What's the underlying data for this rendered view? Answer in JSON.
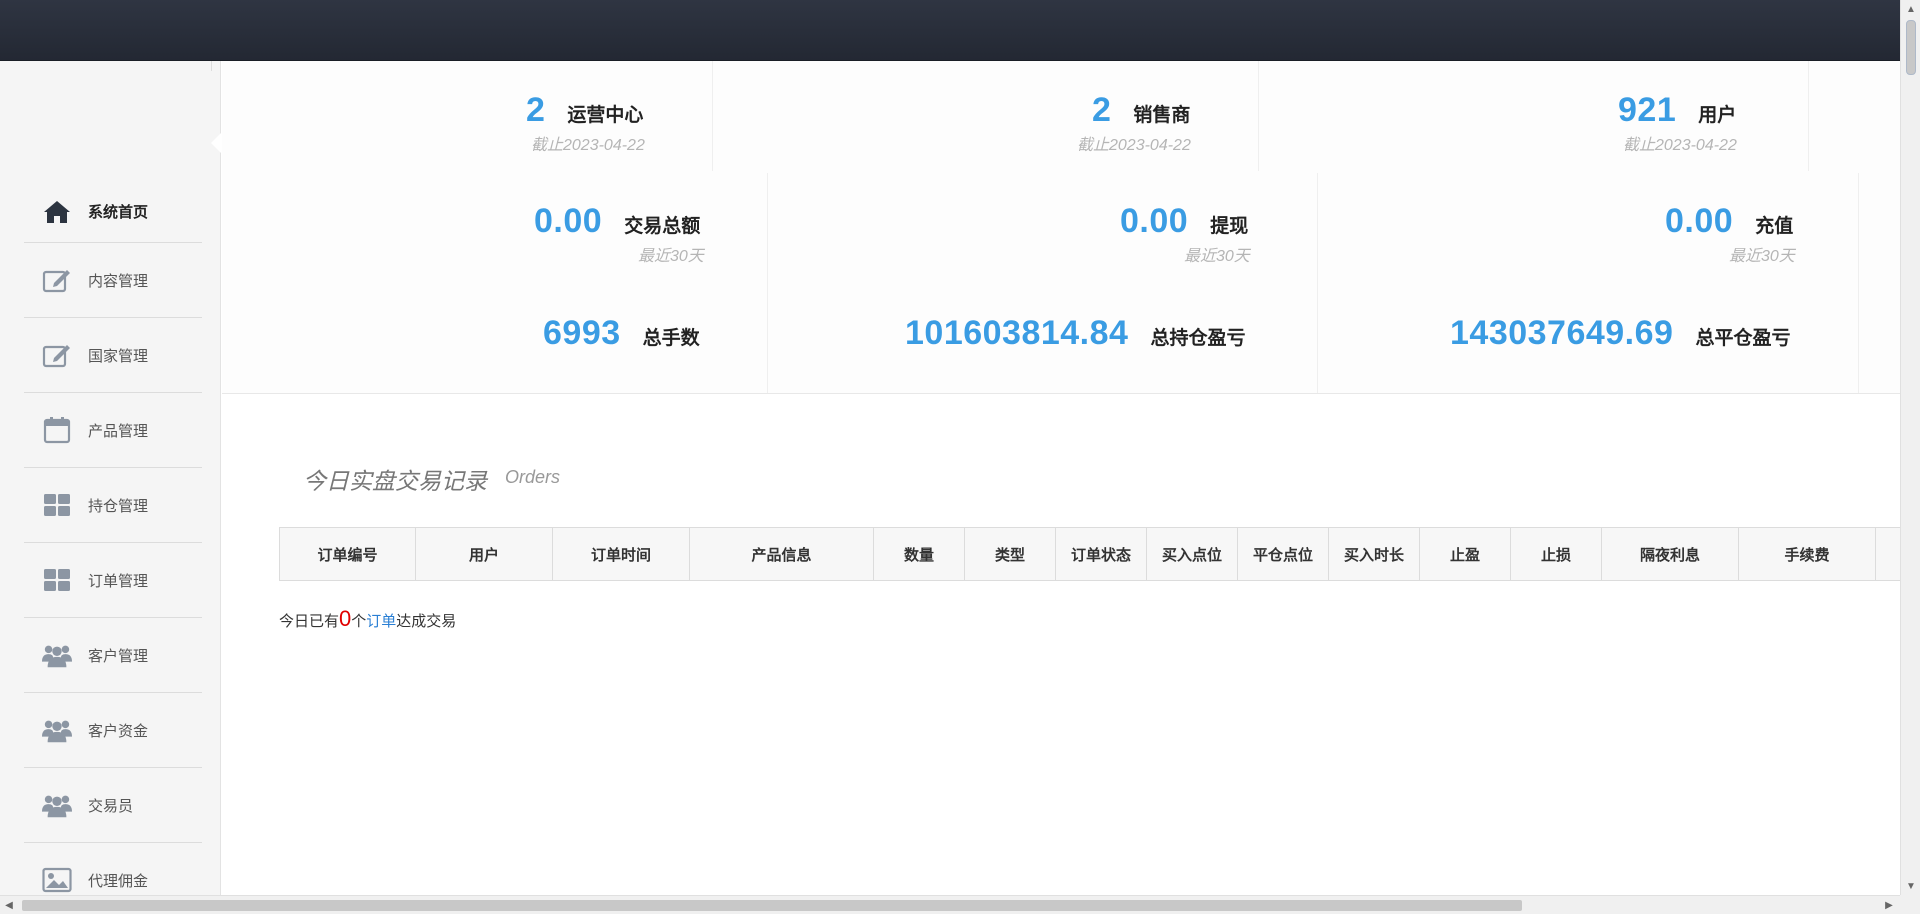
{
  "sidebar": {
    "items": [
      {
        "label": "系统首页",
        "icon": "home-icon"
      },
      {
        "label": "内容管理",
        "icon": "edit-icon"
      },
      {
        "label": "国家管理",
        "icon": "edit-icon"
      },
      {
        "label": "产品管理",
        "icon": "calendar-icon"
      },
      {
        "label": "持仓管理",
        "icon": "grid-icon"
      },
      {
        "label": "订单管理",
        "icon": "grid-icon"
      },
      {
        "label": "客户管理",
        "icon": "users-icon"
      },
      {
        "label": "客户资金",
        "icon": "users-icon"
      },
      {
        "label": "交易员",
        "icon": "users-icon"
      },
      {
        "label": "代理佣金",
        "icon": "image-icon"
      }
    ]
  },
  "stats": {
    "row1": [
      {
        "value": "2",
        "label": "运营中心",
        "sub": "截止2023-04-22"
      },
      {
        "value": "2",
        "label": "销售商",
        "sub": "截止2023-04-22"
      },
      {
        "value": "921",
        "label": "用户",
        "sub": "截止2023-04-22"
      }
    ],
    "row2": [
      {
        "value": "0.00",
        "label": "交易总额",
        "sub": "最近30天"
      },
      {
        "value": "0.00",
        "label": "提现",
        "sub": "最近30天"
      },
      {
        "value": "0.00",
        "label": "充值",
        "sub": "最近30天"
      }
    ],
    "row3": [
      {
        "value": "6993",
        "label": "总手数"
      },
      {
        "value": "101603814.84",
        "label": "总持仓盈亏"
      },
      {
        "value": "143037649.69",
        "label": "总平仓盈亏"
      }
    ]
  },
  "orders": {
    "title": "今日实盘交易记录",
    "subtitle": "Orders",
    "columns": [
      "订单编号",
      "用户",
      "订单时间",
      "产品信息",
      "数量",
      "类型",
      "订单状态",
      "买入点位",
      "平仓点位",
      "买入时长",
      "止盈",
      "止损",
      "隔夜利息",
      "手续费"
    ],
    "note_prefix": "今日已有",
    "note_count": "0",
    "note_unit": "个",
    "note_link": "订单",
    "note_suffix": "达成交易"
  },
  "colors": {
    "accent": "#3a9ce3",
    "topbar": "#2a2f3a",
    "count_red": "#e00000"
  }
}
